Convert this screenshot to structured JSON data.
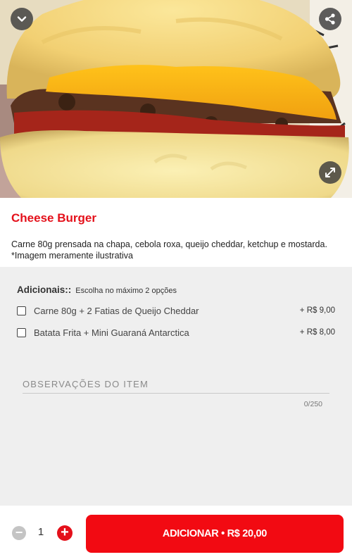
{
  "product": {
    "image_alt": "Cheese Burger",
    "title": "Cheese Burger",
    "description_line1": "Carne 80g prensada na chapa, cebola roxa, queijo cheddar, ketchup e mostarda.",
    "description_line2": "*Imagem meramente ilustrativa"
  },
  "header_icons": {
    "back": "chevron-down-icon",
    "share": "share-icon",
    "expand": "expand-icon"
  },
  "addons": {
    "title": "Adicionais::",
    "hint": "Escolha no máximo 2 opções",
    "options": [
      {
        "label": "Carne 80g + 2 Fatias de Queijo Cheddar",
        "price": "+ R$ 9,00",
        "checked": false
      },
      {
        "label": "Batata Frita + Mini Guaraná Antarctica",
        "price": "+ R$ 8,00",
        "checked": false
      }
    ]
  },
  "notes": {
    "placeholder": "OBSERVAÇÕES DO ITEM",
    "value": "",
    "counter": "0/250"
  },
  "footer": {
    "minus": "−",
    "quantity": "1",
    "plus": "+",
    "add_label": "ADICIONAR • R$ 20,00"
  },
  "colors": {
    "accent": "#e4101a",
    "button": "#f20a12",
    "options_bg": "#efefef"
  }
}
